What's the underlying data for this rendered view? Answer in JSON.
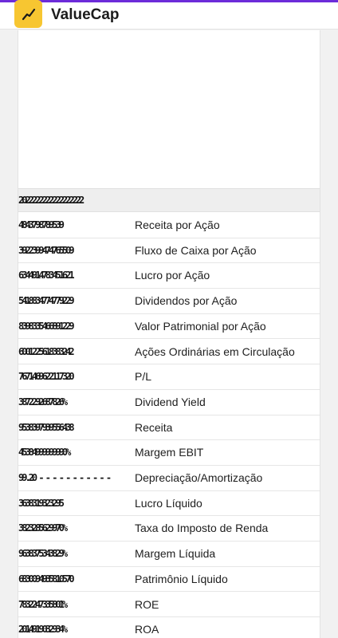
{
  "app": {
    "title": "ValueCap",
    "logo_icon": "trending-up-icon",
    "accent_color": "#f7c631"
  },
  "table": {
    "year_header": "2022222222222222222",
    "rows": [
      {
        "values": "4843798789539",
        "label": "Receita por Ação"
      },
      {
        "values": "3922399474765509",
        "label": "Fluxo de Caixa por Ação"
      },
      {
        "values": "6344914783451621",
        "label": "Lucro por Ação"
      },
      {
        "values": "5418834774779229",
        "label": "Dividendos por Ação"
      },
      {
        "values": "8398335466891229",
        "label": "Valor Patrimonial por Ação"
      },
      {
        "values": "6001225618383242",
        "label": "Ações Ordinárias em Circulação"
      },
      {
        "values": "7671469622117320",
        "label": "P/L"
      },
      {
        "values": "3872292687826%",
        "label": "Dividend Yield"
      },
      {
        "values": "9538397939556438",
        "label": "Receita"
      },
      {
        "values": "45384999999990%",
        "label": "Margem EBIT"
      },
      {
        "values": "99.20 - - - - - - - - - - -",
        "label": "Depreciação/Amortização"
      },
      {
        "values": "3638319323295",
        "label": "Lucro Líquido"
      },
      {
        "values": "3823285629970%",
        "label": "Taxa do Imposto de Renda"
      },
      {
        "values": "9638375343829%",
        "label": "Margem Líquida"
      },
      {
        "values": "6830094935810570",
        "label": "Patrimônio Líquido"
      },
      {
        "values": "7832247335801%",
        "label": "ROE"
      },
      {
        "values": "2014919032934%",
        "label": "ROA"
      }
    ]
  }
}
